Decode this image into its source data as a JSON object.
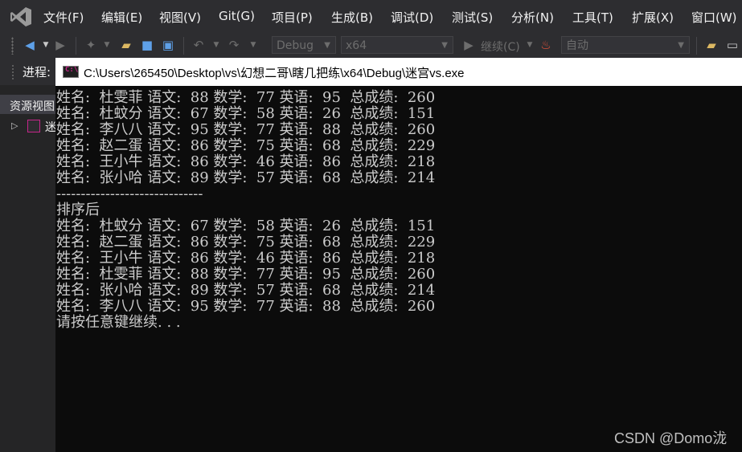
{
  "menubar": {
    "items": [
      "文件(F)",
      "编辑(E)",
      "视图(V)",
      "Git(G)",
      "项目(P)",
      "生成(B)",
      "调试(D)",
      "测试(S)",
      "分析(N)",
      "工具(T)",
      "扩展(X)",
      "窗口(W)"
    ]
  },
  "toolbar": {
    "configuration": "Debug",
    "platform": "x64",
    "continue_label": "继续(C)",
    "auto_label": "自动"
  },
  "process_bar": {
    "label": "进程:"
  },
  "left_panel": {
    "title": "资源视图",
    "tree_item": "迷"
  },
  "console": {
    "title": "C:\\Users\\265450\\Desktop\\vs\\幻想二哥\\瞎几把练\\x64\\Debug\\迷宫vs.exe",
    "lines": [
      "姓名:  杜雯菲 语文:  88 数学:  77 英语:  95  总成绩:  260",
      "姓名:  杜蚊分 语文:  67 数学:  58 英语:  26  总成绩:  151",
      "姓名:  李八八 语文:  95 数学:  77 英语:  88  总成绩:  260",
      "姓名:  赵二蛋 语文:  86 数学:  75 英语:  68  总成绩:  229",
      "姓名:  王小牛 语文:  86 数学:  46 英语:  86  总成绩:  218",
      "姓名:  张小哈 语文:  89 数学:  57 英语:  68  总成绩:  214",
      "------------------------------",
      "排序后",
      "姓名:  杜蚊分 语文:  67 数学:  58 英语:  26  总成绩:  151",
      "姓名:  赵二蛋 语文:  86 数学:  75 英语:  68  总成绩:  229",
      "姓名:  王小牛 语文:  86 数学:  46 英语:  86  总成绩:  218",
      "姓名:  杜雯菲 语文:  88 数学:  77 英语:  95  总成绩:  260",
      "姓名:  张小哈 语文:  89 数学:  57 英语:  68  总成绩:  214",
      "姓名:  李八八 语文:  95 数学:  77 英语:  88  总成绩:  260",
      "请按任意键继续. . ."
    ]
  },
  "watermark": "CSDN @Domo泷",
  "colors": {
    "vs_purple": "#c5258a",
    "console_bg": "#0c0c0c",
    "console_text": "#cccccc",
    "chrome_bg": "#2d2d30"
  }
}
